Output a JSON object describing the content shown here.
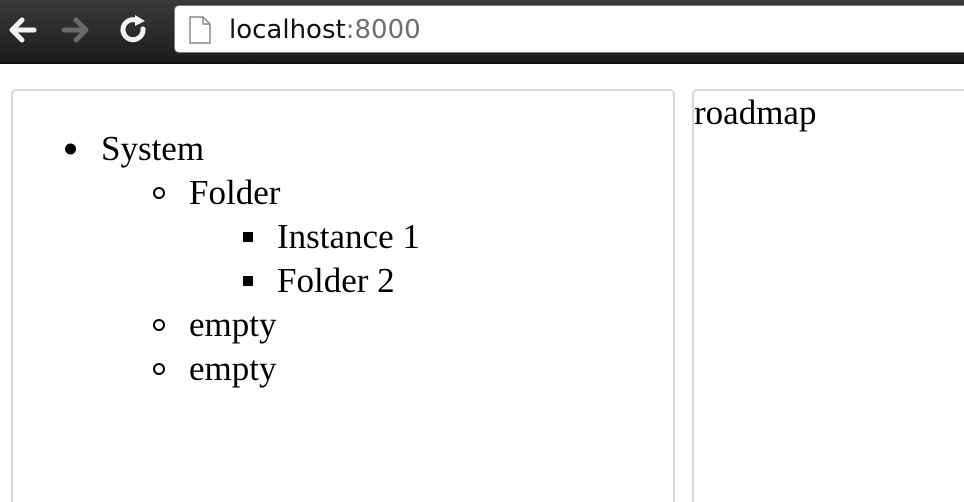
{
  "browser": {
    "url_host": "localhost",
    "url_port": ":8000",
    "icons": {
      "back": "back-arrow-icon",
      "forward": "forward-arrow-icon",
      "reload": "reload-icon",
      "page": "page-icon"
    }
  },
  "tree": {
    "root": "System",
    "folder": "Folder",
    "folder_children": [
      "Instance 1",
      "Folder 2"
    ],
    "siblings": [
      "empty",
      "empty"
    ]
  },
  "roadmap": {
    "label": "roadmap"
  }
}
